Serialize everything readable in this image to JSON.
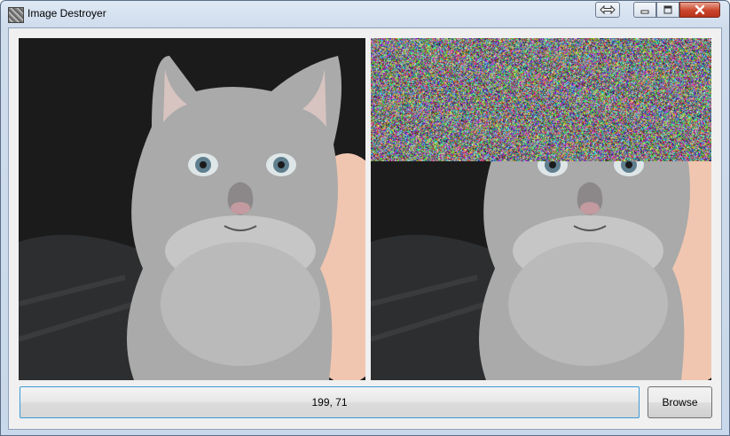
{
  "window": {
    "title": "Image Destroyer",
    "icons": {
      "app": "app-icon",
      "resize": "resize-arrows-icon",
      "minimize": "minimize-icon",
      "maximize": "maximize-icon",
      "close": "close-icon"
    }
  },
  "main": {
    "status_text": "199, 71",
    "browse_label": "Browse",
    "noise_fraction_of_height": 0.36
  },
  "colors": {
    "status_border": "#3c9bd6",
    "close_button": "#c9452b"
  }
}
